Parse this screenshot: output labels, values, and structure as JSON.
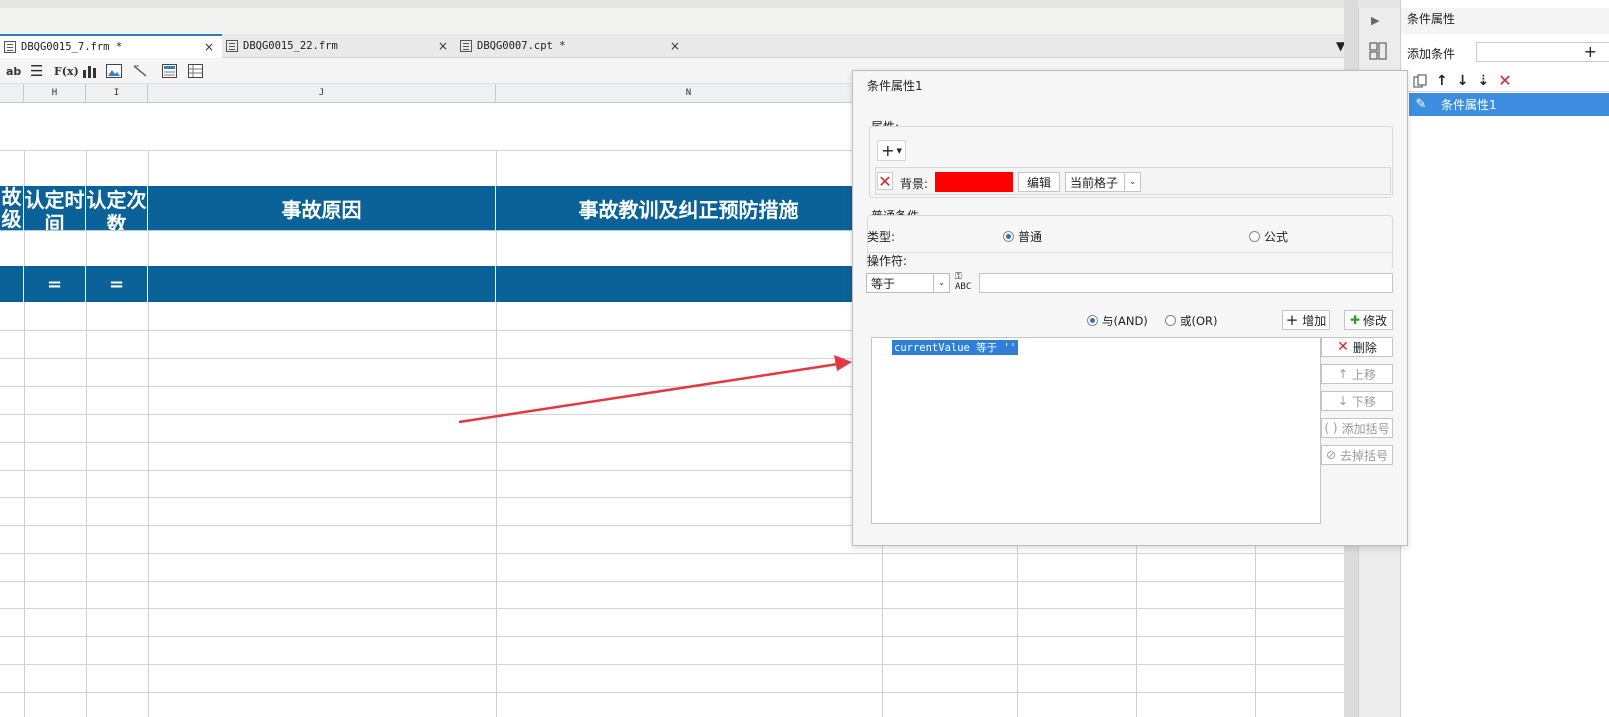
{
  "tabs": [
    {
      "label": "DBQG0015_7.frm *",
      "close": "×"
    },
    {
      "label": "DBQG0015_22.frm",
      "close": "×"
    },
    {
      "label": "DBQG0007.cpt *",
      "close": "×"
    }
  ],
  "toolbar": {
    "ab": "ab",
    "fx": "F(x)"
  },
  "columns": [
    "H",
    "I",
    "J",
    "N"
  ],
  "sheet": {
    "headers": [
      "故级",
      "认定时间",
      "认定次数",
      "事故原因",
      "事故教训及纠正预防措施"
    ],
    "eq": "="
  },
  "cond_pane": {
    "title": "条件属性",
    "add_label": "添加条件",
    "add_symbol": "+",
    "item": "条件属性1",
    "icons": [
      "copy-icon",
      "arrow-up-icon",
      "arrow-down-icon",
      "sort-icon",
      "delete-icon"
    ]
  },
  "dialog": {
    "title": "条件属性1",
    "attr_label": "属性:",
    "add_btn": "+",
    "bg_label": "背景:",
    "bg_color": "#ff0000",
    "edit_btn": "编辑",
    "scope": "当前格子",
    "normal_label": "普通条件",
    "type_label": "类型:",
    "type_normal": "普通",
    "type_formula": "公式",
    "op_label": "操作符:",
    "op_value": "等于",
    "op_input": "",
    "and_label": "与(AND)",
    "or_label": "或(OR)",
    "add_cond": "增加",
    "modify": "修改",
    "condition": "currentValue 等于 ''",
    "btn_delete": "删除",
    "btn_up": "上移",
    "btn_down": "下移",
    "btn_add_bracket": "添加括号",
    "btn_remove_bracket": "去掉括号"
  }
}
